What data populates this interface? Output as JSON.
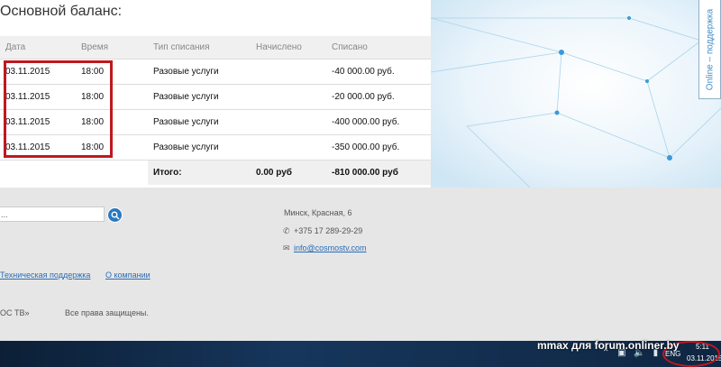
{
  "page": {
    "title": "Основной баланс:",
    "support_tab": "Online – поддержка"
  },
  "table": {
    "headers": [
      "Дата",
      "Время",
      "Тип списания",
      "Начислено",
      "Списано"
    ],
    "rows": [
      {
        "date": "03.11.2015",
        "time": "18:00",
        "type": "Разовые услуги",
        "credited": "",
        "debited": "-40 000.00 руб."
      },
      {
        "date": "03.11.2015",
        "time": "18:00",
        "type": "Разовые услуги",
        "credited": "",
        "debited": "-20 000.00 руб."
      },
      {
        "date": "03.11.2015",
        "time": "18:00",
        "type": "Разовые услуги",
        "credited": "",
        "debited": "-400 000.00 руб."
      },
      {
        "date": "03.11.2015",
        "time": "18:00",
        "type": "Разовые услуги",
        "credited": "",
        "debited": "-350 000.00 руб."
      }
    ],
    "total": {
      "label": "Итого:",
      "credited": "0.00 руб",
      "debited": "-810 000.00 руб"
    }
  },
  "footer": {
    "search_value": "...",
    "address": "Минск, Красная, 6",
    "phone": "+375 17 289-29-29",
    "email": "info@cosmostv.com",
    "links": [
      "Техническая поддержка",
      "О компании"
    ],
    "copyright_brand": "ОС ТВ»",
    "rights": "Все права защищены."
  },
  "taskbar": {
    "language": "ENG",
    "time": "5:11",
    "date": "03.11.2015",
    "watermark": "mmax для forum.onliner.by"
  },
  "colors": {
    "highlight": "#c0171f",
    "link": "#2a6db5",
    "taskbar": "#0f2642"
  }
}
